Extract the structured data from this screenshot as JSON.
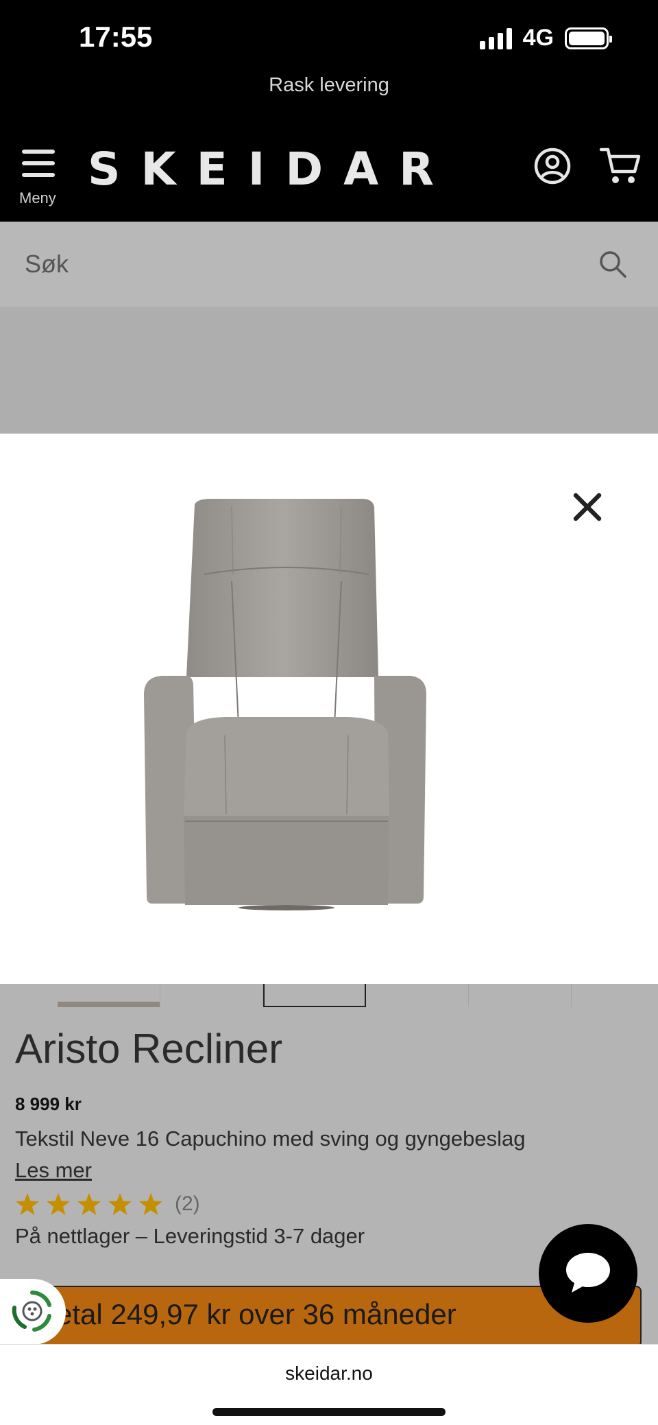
{
  "status_bar": {
    "time": "17:55",
    "network": "4G",
    "signal_bars": 4,
    "battery_level": 1.0
  },
  "promo": {
    "text": "Rask levering"
  },
  "header": {
    "menu_label": "Meny",
    "logo": "SKEIDAR",
    "account_icon": "user-circle-icon",
    "cart_icon": "cart-icon"
  },
  "search": {
    "placeholder": "Søk",
    "icon": "search-icon"
  },
  "modal": {
    "close_icon": "close-icon",
    "image": "recliner-chair"
  },
  "product": {
    "thumbnail_count": 6,
    "active_thumbnail": 3,
    "title": "Aristo Recliner",
    "price": "8 999 kr",
    "description": "Tekstil Neve 16 Capuchino med sving og gyngebeslag",
    "read_more": "Les mer",
    "rating": {
      "stars": 5,
      "count": "(2)"
    },
    "availability": "På nettlager – Leveringstid 3-7 dager"
  },
  "finance": {
    "label": "etal 249,97 kr over 36 måneder"
  },
  "chat": {
    "icon": "chat-bubble-icon"
  },
  "eco": {
    "icon": "recycle-icon"
  },
  "browser": {
    "url": "skeidar.no"
  },
  "colors": {
    "accent": "#b8670f",
    "star": "#e0a800",
    "header_bg": "#000000",
    "overlay": "#b4b4b4"
  }
}
